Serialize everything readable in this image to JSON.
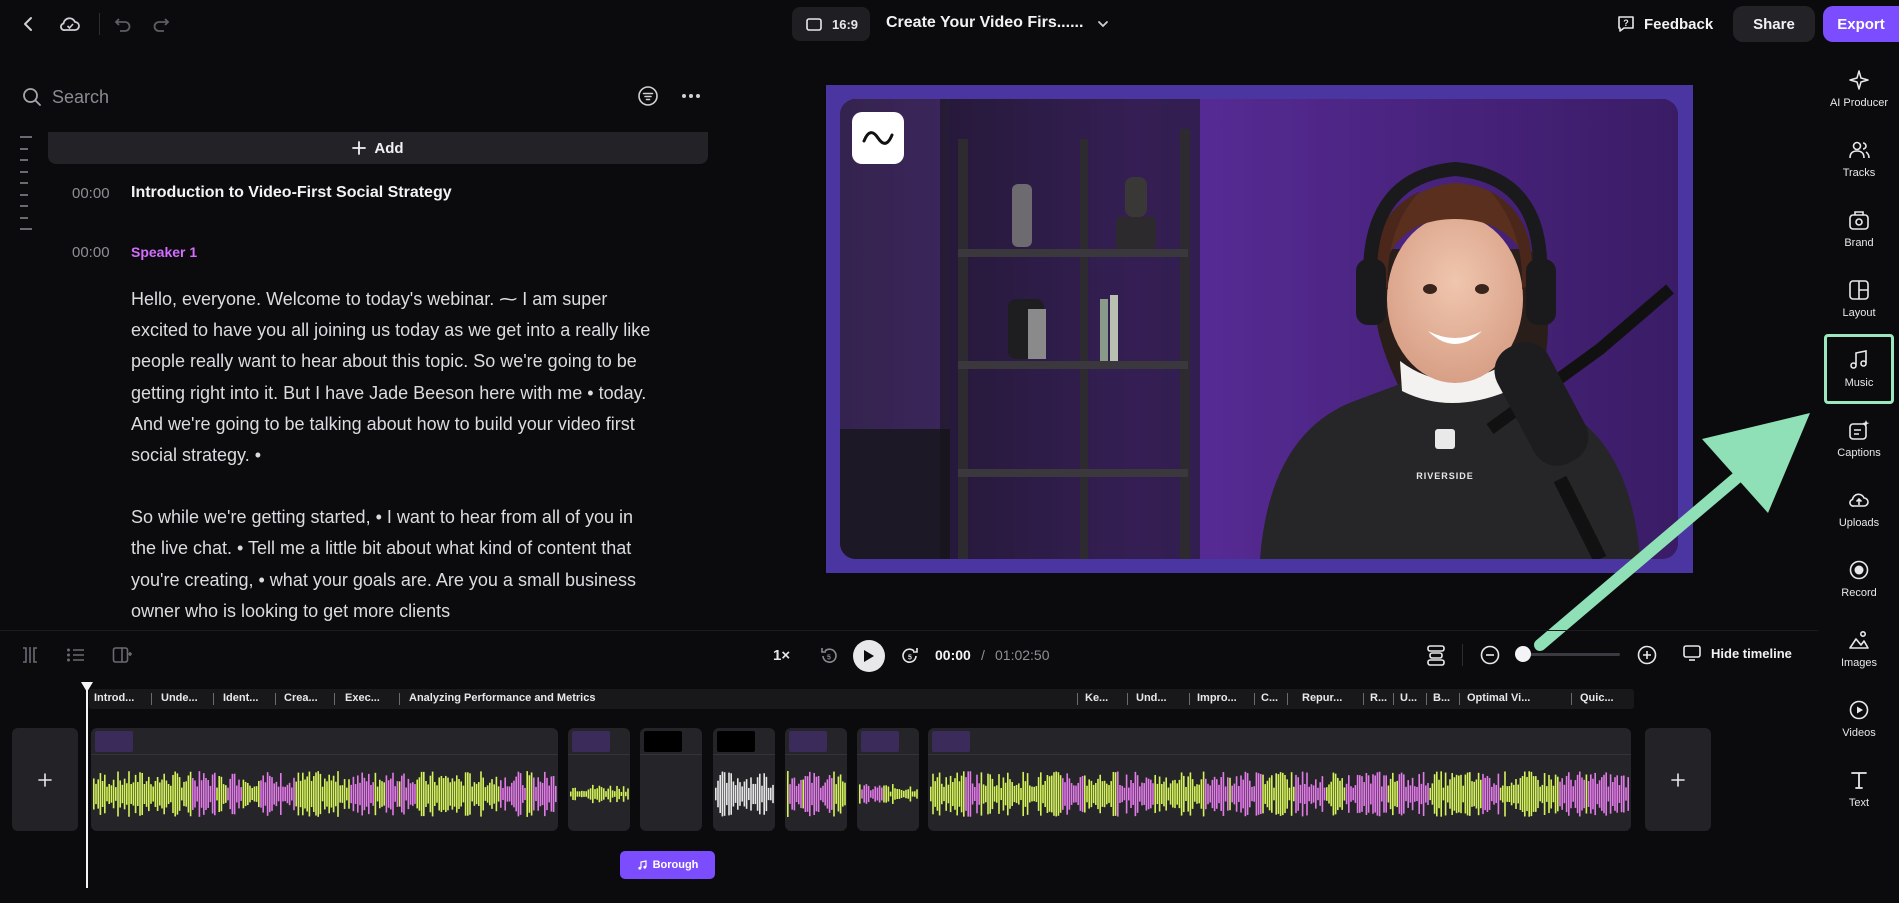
{
  "header": {
    "aspect_ratio": "16:9",
    "title": "Create Your Video Firs......",
    "feedback_label": "Feedback",
    "share_label": "Share",
    "export_label": "Export"
  },
  "transcript": {
    "search_placeholder": "Search",
    "add_label": "Add",
    "chapter_time": "00:00",
    "chapter_title": "Introduction to Video-First Social Strategy",
    "speaker_time": "00:00",
    "speaker": "Speaker 1",
    "paragraph_1": "Hello, everyone. Welcome to today's webinar. ⁓ I am super excited to have you all joining us today as we get into a really like people really want to hear about this topic. So we're going to be getting right into it. But I have Jade Beeson here with me • today. And we're going to be talking about how to build your video first social strategy. •",
    "paragraph_2": "So while we're getting started, • I want to hear from all of you in the live chat. • Tell me a little bit about what kind of content that you're creating, • what your goals are. Are you a small business owner who is looking to get more clients"
  },
  "preview": {
    "shirt_text": "RIVERSIDE"
  },
  "rail": {
    "items": [
      {
        "label": "AI Producer",
        "icon": "sparkle-icon"
      },
      {
        "label": "Tracks",
        "icon": "people-icon"
      },
      {
        "label": "Brand",
        "icon": "brand-kit-icon"
      },
      {
        "label": "Layout",
        "icon": "layout-icon"
      },
      {
        "label": "Music",
        "icon": "music-note-icon",
        "active": true
      },
      {
        "label": "Captions",
        "icon": "captions-icon"
      },
      {
        "label": "Uploads",
        "icon": "upload-cloud-icon"
      },
      {
        "label": "Record",
        "icon": "record-icon"
      },
      {
        "label": "Images",
        "icon": "image-icon"
      },
      {
        "label": "Videos",
        "icon": "play-circle-icon"
      },
      {
        "label": "Text",
        "icon": "text-icon"
      }
    ]
  },
  "controls": {
    "speed": "1×",
    "time_current": "00:00",
    "time_separator": "/",
    "time_total": "01:02:50",
    "hide_timeline_label": "Hide timeline",
    "zoom_level": 0
  },
  "timeline": {
    "chapters": [
      "Introd...",
      "Unde...",
      "Ident...",
      "Crea...",
      "Exec...",
      "Analyzing Performance and Metrics",
      "Ke...",
      "Und...",
      "Impro...",
      "C...",
      "Repur...",
      "R...",
      "U...",
      "B...",
      "Optimal Vi...",
      "Quic..."
    ],
    "music_clip_label": "Borough",
    "colors": {
      "waveform_main": "#d4f25a",
      "waveform_alt": "#e27ae8",
      "waveform_white": "#e6e6e6",
      "accent": "#7c4dff"
    }
  }
}
